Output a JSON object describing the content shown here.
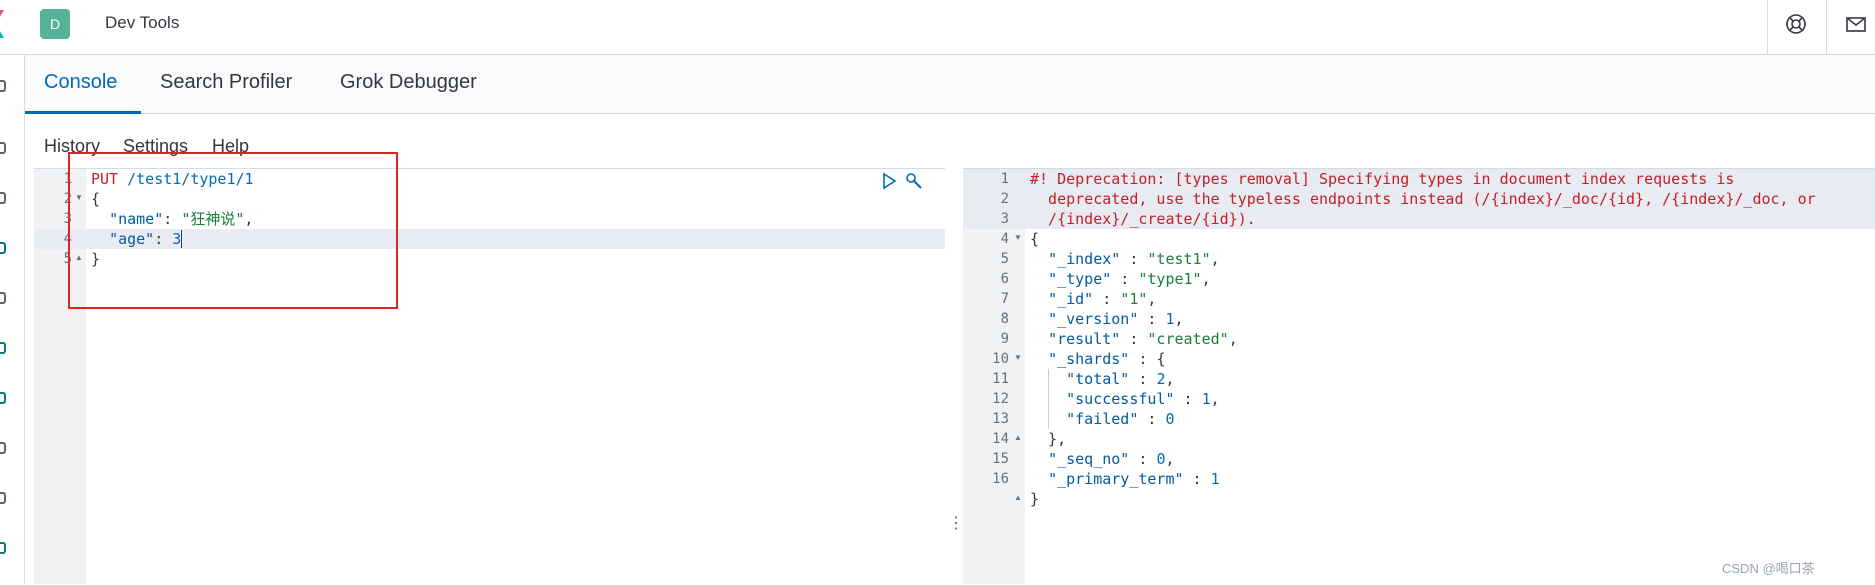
{
  "header": {
    "app_badge": "D",
    "title": "Dev Tools",
    "icons": [
      "help-ring-icon",
      "mail-icon"
    ],
    "brand_color": "#54b399"
  },
  "tabs": [
    {
      "label": "Console",
      "active": true
    },
    {
      "label": "Search Profiler",
      "active": false
    },
    {
      "label": "Grok Debugger",
      "active": false
    }
  ],
  "menu": {
    "history": "History",
    "settings": "Settings",
    "help": "Help"
  },
  "request": {
    "line_numbers": [
      "1",
      "2",
      "3",
      "4",
      "5"
    ],
    "method": "PUT",
    "url": "/test1/type1/1",
    "open_brace": "{",
    "name_key": "\"name\"",
    "name_colon": ": ",
    "name_value": "\"狂神说\"",
    "name_comma": ",",
    "age_key": "\"age\"",
    "age_colon": ": ",
    "age_value": "3",
    "close_brace": "}"
  },
  "response": {
    "line_numbers": [
      "1",
      "",
      "",
      "2",
      "3",
      "4",
      "5",
      "6",
      "7",
      "8",
      "9",
      "10",
      "11",
      "12",
      "13",
      "14",
      "15",
      "16"
    ],
    "warning_lines": [
      "#! Deprecation: [types removal] Specifying types in document index requests is",
      "  deprecated, use the typeless endpoints instead (/{index}/_doc/{id}, /{index}/_doc, or",
      "  /{index}/_create/{id})."
    ],
    "lines": [
      {
        "k": "",
        "v": "",
        "pre": "{"
      },
      {
        "k": "\"_index\"",
        "v": "\"test1\"",
        "pre": "  ",
        "post": ",",
        "type": "str"
      },
      {
        "k": "\"_type\"",
        "v": "\"type1\"",
        "pre": "  ",
        "post": ",",
        "type": "str"
      },
      {
        "k": "\"_id\"",
        "v": "\"1\"",
        "pre": "  ",
        "post": ",",
        "type": "str"
      },
      {
        "k": "\"_version\"",
        "v": "1",
        "pre": "  ",
        "post": ",",
        "type": "num"
      },
      {
        "k": "\"result\"",
        "v": "\"created\"",
        "pre": "  ",
        "post": ",",
        "type": "str"
      },
      {
        "k": "\"_shards\"",
        "v": "{",
        "pre": "  ",
        "post": "",
        "type": "punc"
      },
      {
        "k": "\"total\"",
        "v": "2",
        "pre": "    ",
        "post": ",",
        "type": "num"
      },
      {
        "k": "\"successful\"",
        "v": "1",
        "pre": "    ",
        "post": ",",
        "type": "num"
      },
      {
        "k": "\"failed\"",
        "v": "0",
        "pre": "    ",
        "post": "",
        "type": "num"
      },
      {
        "k": "",
        "v": "",
        "pre": "  },"
      },
      {
        "k": "\"_seq_no\"",
        "v": "0",
        "pre": "  ",
        "post": ",",
        "type": "num"
      },
      {
        "k": "\"_primary_term\"",
        "v": "1",
        "pre": "  ",
        "post": "",
        "type": "num"
      },
      {
        "k": "",
        "v": "",
        "pre": "}"
      },
      {
        "k": "",
        "v": "",
        "pre": ""
      }
    ]
  },
  "watermark": "CSDN @喝口茶"
}
